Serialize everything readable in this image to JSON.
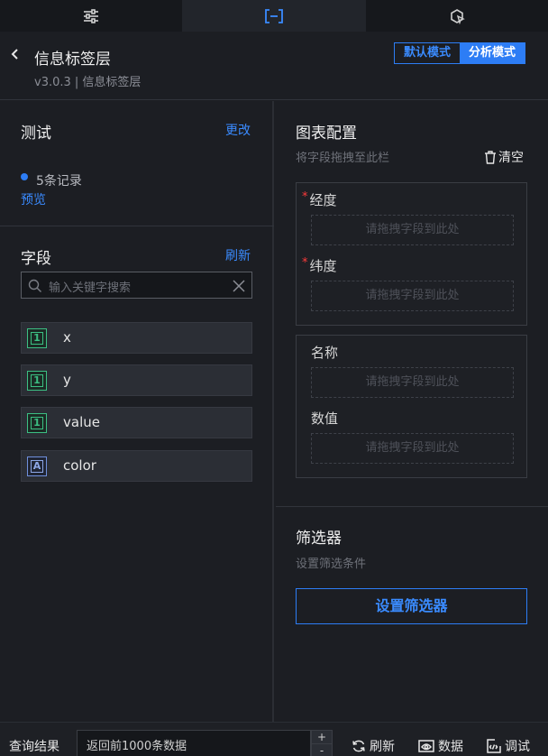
{
  "header": {
    "title": "信息标签层",
    "version": "v3.0.3 | 信息标签层",
    "modes": [
      "默认模式",
      "分析模式"
    ],
    "active_mode": "分析模式"
  },
  "left": {
    "test_title": "测试",
    "change_label": "更改",
    "records": "5条记录",
    "preview": "预览",
    "fields_title": "字段",
    "refresh_label": "刷新",
    "search_placeholder": "输入关键字搜索",
    "fields": [
      {
        "type": "1",
        "name": "x"
      },
      {
        "type": "1",
        "name": "y"
      },
      {
        "type": "1",
        "name": "value"
      },
      {
        "type": "A",
        "name": "color"
      }
    ]
  },
  "right": {
    "chart_title": "图表配置",
    "drag_hint": "将字段拖拽至此栏",
    "clear_label": "清空",
    "drop_placeholder": "请拖拽字段到此处",
    "groups": [
      [
        {
          "label": "经度",
          "required": true
        },
        {
          "label": "纬度",
          "required": true
        }
      ],
      [
        {
          "label": "名称",
          "required": false
        },
        {
          "label": "数值",
          "required": false
        }
      ]
    ],
    "required_mark": "*",
    "filter_title": "筛选器",
    "filter_hint": "设置筛选条件",
    "filter_button": "设置筛选器"
  },
  "bottom": {
    "query_label": "查询结果",
    "query_value": "返回前1000条数据",
    "plus": "+",
    "minus": "-",
    "refresh": "刷新",
    "data": "数据",
    "debug": "调试"
  },
  "colors": {
    "accent": "#2d7df5",
    "number_type": "#3cbf83",
    "string_type": "#8da7e6",
    "required": "#ff3b3b"
  }
}
